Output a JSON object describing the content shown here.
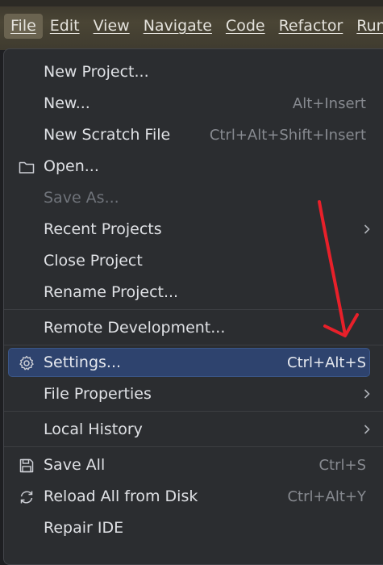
{
  "menubar": {
    "items": [
      {
        "label": "File"
      },
      {
        "label": "Edit"
      },
      {
        "label": "View"
      },
      {
        "label": "Navigate"
      },
      {
        "label": "Code"
      },
      {
        "label": "Refactor"
      },
      {
        "label": "Run"
      }
    ]
  },
  "file_menu": {
    "items": [
      {
        "label": "New Project...",
        "shortcut": ""
      },
      {
        "label": "New...",
        "shortcut": "Alt+Insert"
      },
      {
        "label": "New Scratch File",
        "shortcut": "Ctrl+Alt+Shift+Insert"
      },
      {
        "label": "Open...",
        "shortcut": "",
        "icon": "folder-icon"
      },
      {
        "label": "Save As...",
        "shortcut": "",
        "disabled": true
      },
      {
        "label": "Recent Projects",
        "submenu": true
      },
      {
        "label": "Close Project",
        "shortcut": ""
      },
      {
        "label": "Rename Project...",
        "shortcut": ""
      },
      {
        "label": "Remote Development...",
        "shortcut": ""
      },
      {
        "label": "Settings...",
        "shortcut": "Ctrl+Alt+S",
        "icon": "gear-icon",
        "selected": true
      },
      {
        "label": "File Properties",
        "submenu": true
      },
      {
        "label": "Local History",
        "submenu": true
      },
      {
        "label": "Save All",
        "shortcut": "Ctrl+S",
        "icon": "save-icon"
      },
      {
        "label": "Reload All from Disk",
        "shortcut": "Ctrl+Alt+Y",
        "icon": "reload-icon"
      },
      {
        "label": "Repair IDE",
        "shortcut": ""
      }
    ]
  },
  "annotation": {
    "color": "#e8202a"
  }
}
